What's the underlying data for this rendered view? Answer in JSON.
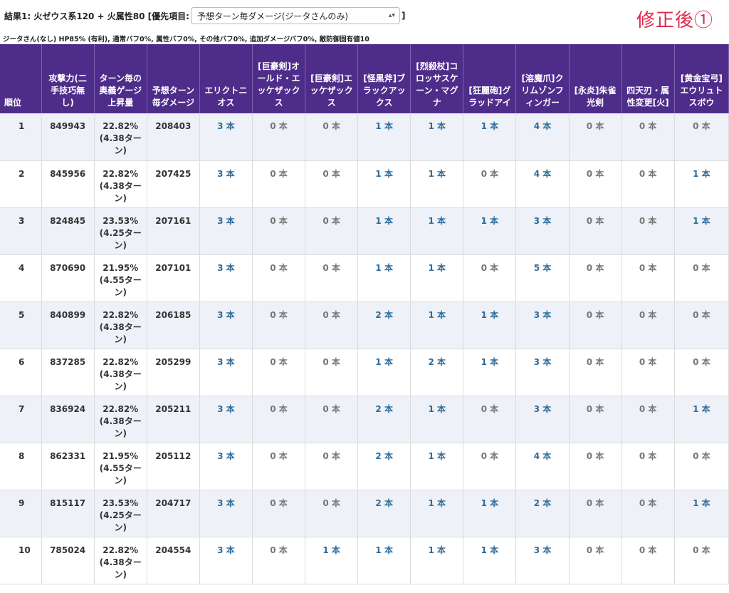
{
  "header": {
    "prefix": "結果1: 火ゼウス系120 + 火属性80 [優先項目:",
    "select_value": "予想ターン毎ダメージ(ジータさんのみ)",
    "select_arrows": "▴▾",
    "suffix": "]",
    "title_right": "修正後①"
  },
  "subtitle": "ジータさん(なし) HP85% (有利), 通常バフ0%, 属性バフ0%, その他バフ0%, 追加ダメージバフ0%, 敵防御固有値10",
  "columns": [
    "順位",
    "攻撃力(二手技巧無し)",
    "ターン毎の 奥義ゲージ上昇量",
    "予想ターン毎ダメージ",
    "エリクトニオス",
    "[巨豪剣]オールド・エッケザックス",
    "[巨豪剣]エッケザックス",
    "[怪黒斧]ブラックアックス",
    "[烈殺杖]コロッサスケーン・マグナ",
    "[狂麗砲]グラッドアイ",
    "[溶魔爪]クリムゾンフィンガー",
    "[永炎]朱雀光剣",
    "四天刃・属性変更[火]",
    "[黄金宝弓]エウリュトスボウ"
  ],
  "rows": [
    {
      "rank": "1",
      "atk": "849943",
      "gauge": "22.82% (4.38ターン)",
      "dmg": "208403",
      "w": [
        "3 本",
        "0 本",
        "0 本",
        "1 本",
        "1 本",
        "1 本",
        "4 本",
        "0 本",
        "0 本",
        "0 本"
      ]
    },
    {
      "rank": "2",
      "atk": "845956",
      "gauge": "22.82% (4.38ターン)",
      "dmg": "207425",
      "w": [
        "3 本",
        "0 本",
        "0 本",
        "1 本",
        "1 本",
        "0 本",
        "4 本",
        "0 本",
        "0 本",
        "1 本"
      ]
    },
    {
      "rank": "3",
      "atk": "824845",
      "gauge": "23.53% (4.25ターン)",
      "dmg": "207161",
      "w": [
        "3 本",
        "0 本",
        "0 本",
        "1 本",
        "1 本",
        "1 本",
        "3 本",
        "0 本",
        "0 本",
        "1 本"
      ]
    },
    {
      "rank": "4",
      "atk": "870690",
      "gauge": "21.95% (4.55ターン)",
      "dmg": "207101",
      "w": [
        "3 本",
        "0 本",
        "0 本",
        "1 本",
        "1 本",
        "0 本",
        "5 本",
        "0 本",
        "0 本",
        "0 本"
      ]
    },
    {
      "rank": "5",
      "atk": "840899",
      "gauge": "22.82% (4.38ターン)",
      "dmg": "206185",
      "w": [
        "3 本",
        "0 本",
        "0 本",
        "2 本",
        "1 本",
        "1 本",
        "3 本",
        "0 本",
        "0 本",
        "0 本"
      ]
    },
    {
      "rank": "6",
      "atk": "837285",
      "gauge": "22.82% (4.38ターン)",
      "dmg": "205299",
      "w": [
        "3 本",
        "0 本",
        "0 本",
        "1 本",
        "2 本",
        "1 本",
        "3 本",
        "0 本",
        "0 本",
        "0 本"
      ]
    },
    {
      "rank": "7",
      "atk": "836924",
      "gauge": "22.82% (4.38ターン)",
      "dmg": "205211",
      "w": [
        "3 本",
        "0 本",
        "0 本",
        "2 本",
        "1 本",
        "0 本",
        "3 本",
        "0 本",
        "0 本",
        "1 本"
      ]
    },
    {
      "rank": "8",
      "atk": "862331",
      "gauge": "21.95% (4.55ターン)",
      "dmg": "205112",
      "w": [
        "3 本",
        "0 本",
        "0 本",
        "2 本",
        "1 本",
        "0 本",
        "4 本",
        "0 本",
        "0 本",
        "0 本"
      ]
    },
    {
      "rank": "9",
      "atk": "815117",
      "gauge": "23.53% (4.25ターン)",
      "dmg": "204717",
      "w": [
        "3 本",
        "0 本",
        "0 本",
        "2 本",
        "1 本",
        "1 本",
        "2 本",
        "0 本",
        "0 本",
        "1 本"
      ]
    },
    {
      "rank": "10",
      "atk": "785024",
      "gauge": "22.82% (4.38ターン)",
      "dmg": "204554",
      "w": [
        "3 本",
        "0 本",
        "1 本",
        "1 本",
        "1 本",
        "1 本",
        "3 本",
        "0 本",
        "0 本",
        "0 本"
      ]
    }
  ],
  "colors": {
    "header_bg": "#4e2d8a",
    "count_color": "#2e6b9a",
    "zero_color": "#777777",
    "row_stripe": "#eef1f7",
    "title_red": "#e0284b"
  }
}
